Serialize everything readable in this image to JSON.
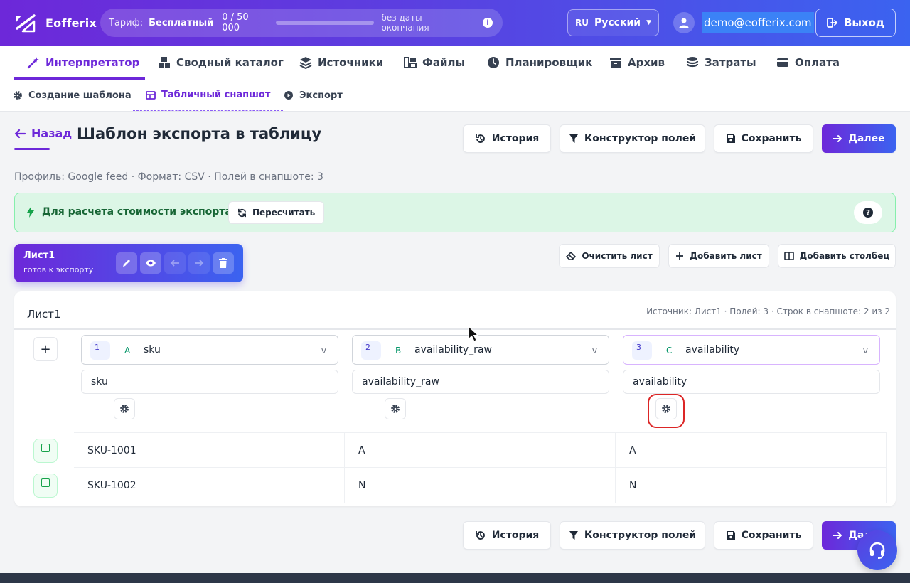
{
  "brand": {
    "name": "Eofferix"
  },
  "plan": {
    "label": "Тариф:",
    "name": "Бесплатный",
    "count": "0 / 50 000",
    "progress": 0.0,
    "until": "без даты окончания"
  },
  "language": {
    "code": "RU",
    "name": "Русский"
  },
  "user": {
    "email": "demo@eofferix.com"
  },
  "logout_label": "Выход",
  "nav": [
    {
      "label": "Интерпретатор",
      "icon": "magic-wand-icon",
      "active": true
    },
    {
      "label": "Сводный каталог",
      "icon": "boxes-icon"
    },
    {
      "label": "Источники",
      "icon": "layers-icon"
    },
    {
      "label": "Файлы",
      "icon": "files-icon"
    },
    {
      "label": "Планировщик",
      "icon": "clock-icon"
    },
    {
      "label": "Архив",
      "icon": "archive-icon"
    },
    {
      "label": "Затраты",
      "icon": "coins-icon"
    },
    {
      "label": "Оплата",
      "icon": "credit-card-icon"
    }
  ],
  "subnav": [
    {
      "label": "Создание шаблона",
      "icon": "gear-icon"
    },
    {
      "label": "Табличный снапшот",
      "icon": "table-icon",
      "active": true
    },
    {
      "label": "Экспорт",
      "icon": "play-icon"
    }
  ],
  "page": {
    "back_label": "Назад",
    "title": "Шаблон экспорта в таблицу",
    "profile": "Профиль: Google feed · Формат: CSV · Полей в снапшоте: 3"
  },
  "actions": {
    "history": "История",
    "fields": "Конструктор полей",
    "save": "Сохранить",
    "next": "Далее"
  },
  "banner": {
    "text": "Для расчета стоимости экспорта",
    "recalc": "Пересчитать",
    "help": "?"
  },
  "sheet": {
    "name": "Лист1",
    "status": "готов к экспорту"
  },
  "sheet_actions": {
    "clear": "Очистить лист",
    "add_sheet": "Добавить лист",
    "add_column": "Добавить столбец"
  },
  "grid": {
    "title": "Лист1",
    "meta": "Источник: Лист1 · Полей: 3 · Строк в снапшоте: 2 из 2",
    "add_label": "+",
    "columns": [
      {
        "num": "1",
        "letter": "A",
        "key": "sku",
        "input": "sku"
      },
      {
        "num": "2",
        "letter": "B",
        "key": "availability_raw",
        "input": "availability_raw"
      },
      {
        "num": "3",
        "letter": "C",
        "key": "availability",
        "input": "availability"
      }
    ],
    "caret": "v",
    "rows": [
      [
        "SKU-1001",
        "A",
        "A"
      ],
      [
        "SKU-1002",
        "N",
        "N"
      ]
    ]
  },
  "colors": {
    "accent": "#6d28d9",
    "accent2": "#3b63f0",
    "success_bg": "#dcf6e6",
    "highlight": "#dc2626"
  }
}
